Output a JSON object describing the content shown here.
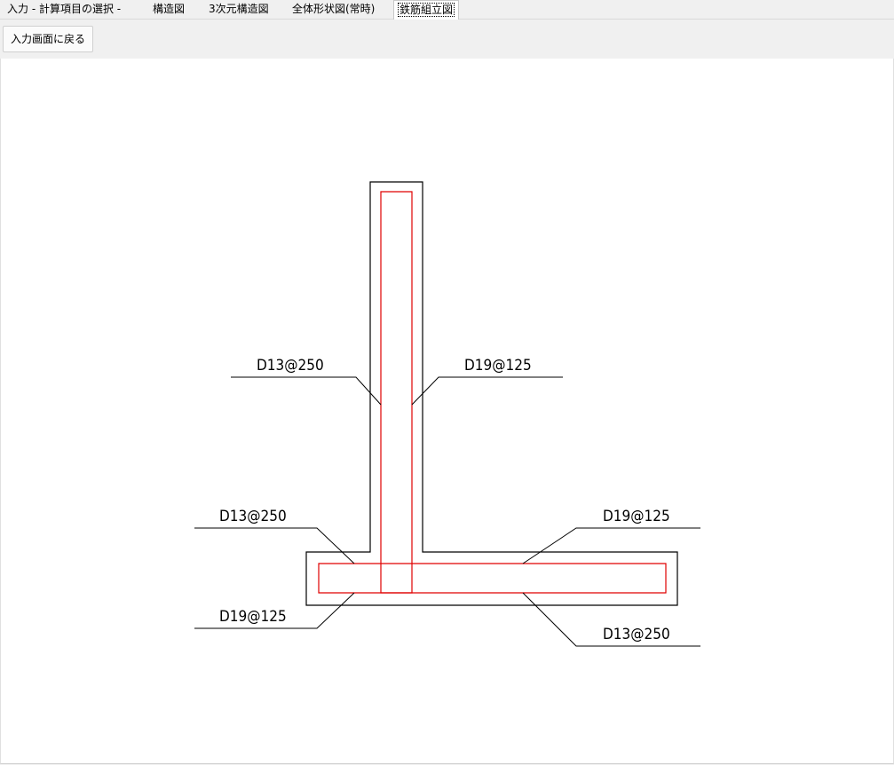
{
  "tabs": [
    {
      "label": "入力 - 計算項目の選択 -",
      "active": false
    },
    {
      "label": "構造図",
      "active": false
    },
    {
      "label": "3次元構造図",
      "active": false
    },
    {
      "label": "全体形状図(常時)",
      "active": false
    },
    {
      "label": "鉄筋組立図",
      "active": true
    }
  ],
  "toolbar": {
    "back_button_label": "入力画面に戻る"
  },
  "drawing": {
    "concrete_color": "#000000",
    "rebar_color": "#e00000",
    "labels": {
      "wall_inner_left": "D13@250",
      "wall_outer_right": "D19@125",
      "footing_top_left": "D13@250",
      "footing_top_right": "D19@125",
      "footing_bottom_left": "D19@125",
      "footing_bottom_right": "D13@250"
    }
  }
}
